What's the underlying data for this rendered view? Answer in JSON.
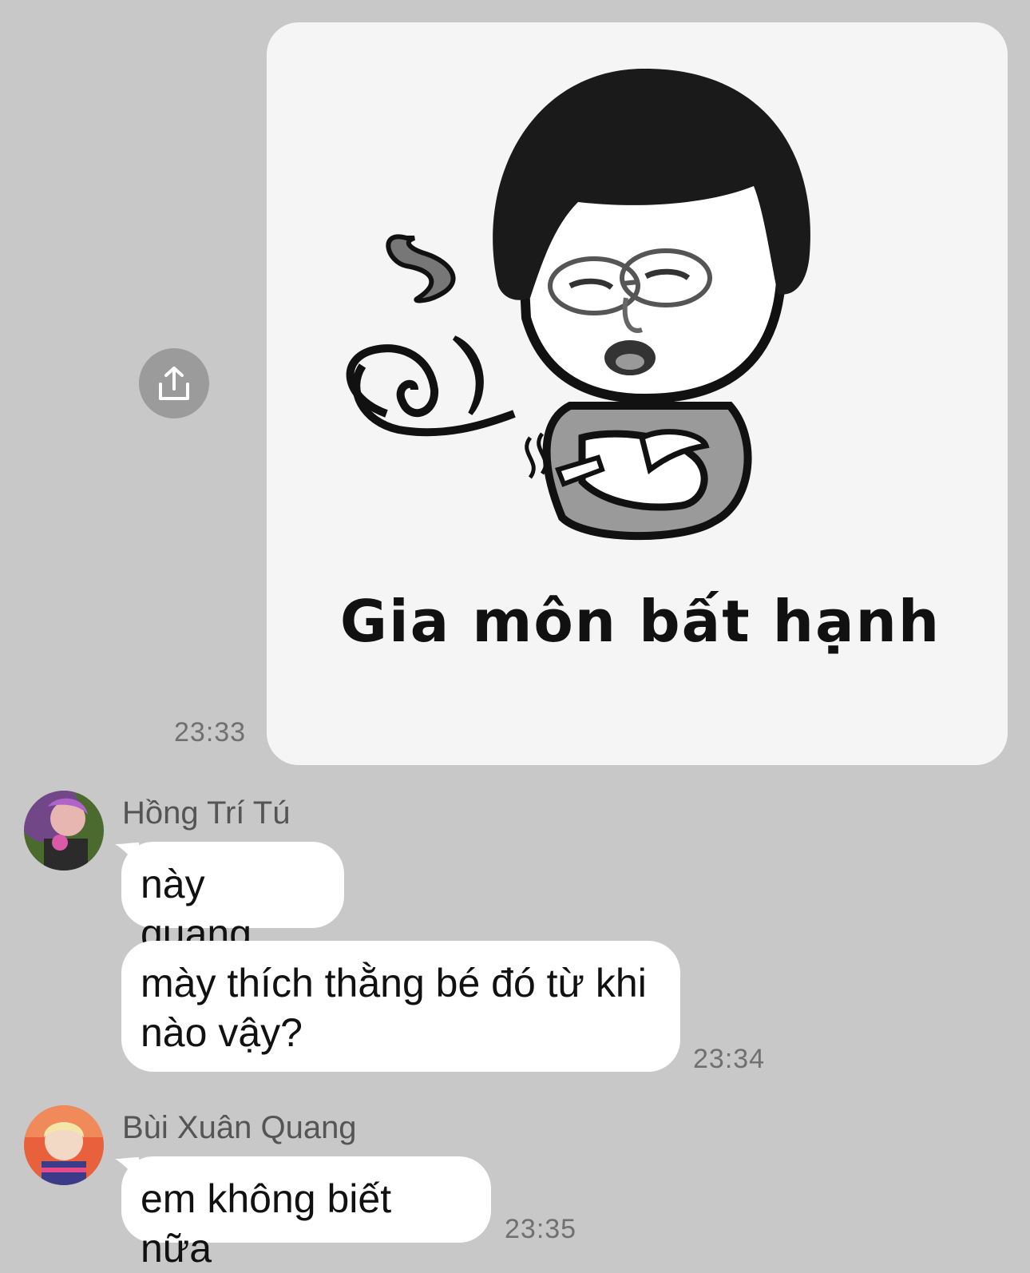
{
  "messages": [
    {
      "type": "sticker",
      "caption": "Gia môn bất hạnh",
      "time": "23:33"
    },
    {
      "sender": "Hồng Trí Tú",
      "bubbles": [
        "này quang",
        "mày thích thằng bé đó từ khi nào vậy?"
      ],
      "time": "23:34"
    },
    {
      "sender": "Bùi Xuân Quang",
      "bubbles": [
        "em không biết nữa"
      ],
      "time": "23:35"
    }
  ],
  "colors": {
    "background": "#c8c8c8",
    "bubble": "#ffffff",
    "share_button": "#9b9b9b",
    "timestamp": "#707070"
  },
  "icons": [
    "share-icon",
    "user-avatar"
  ]
}
